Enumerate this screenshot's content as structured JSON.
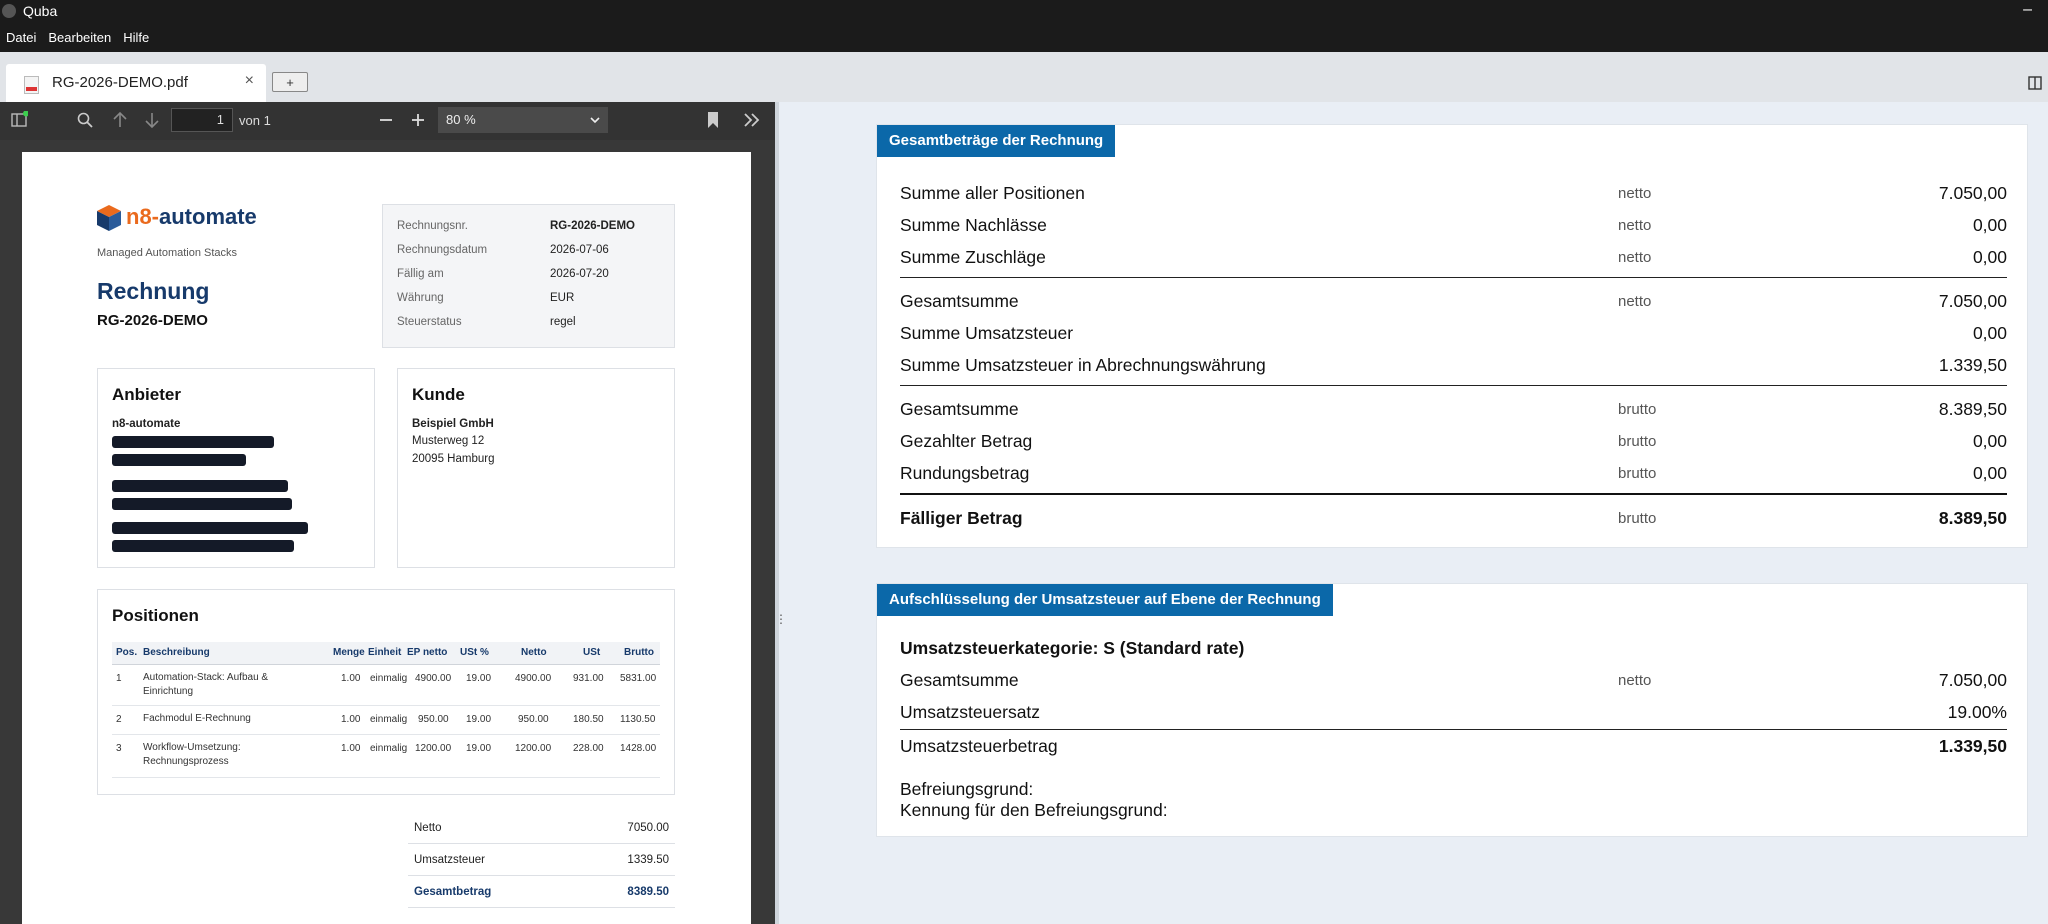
{
  "app": {
    "title": "Quba",
    "menu": [
      "Datei",
      "Bearbeiten",
      "Hilfe"
    ],
    "minimize_glyph": "–"
  },
  "tabs": {
    "active_label": "RG-2026-DEMO.pdf",
    "close_glyph": "×",
    "new_tab_glyph": "+"
  },
  "viewer_toolbar": {
    "page_current": "1",
    "page_total_label": "von 1",
    "zoom": "80 %"
  },
  "invoice": {
    "brand": {
      "part1": "n8-",
      "part2": "automate",
      "slogan": "Managed Automation Stacks"
    },
    "title": "Rechnung",
    "number": "RG-2026-DEMO",
    "meta": [
      {
        "k": "Rechnungsnr.",
        "v": "RG-2026-DEMO"
      },
      {
        "k": "Rechnungsdatum",
        "v": "2026-07-06"
      },
      {
        "k": "Fällig am",
        "v": "2026-07-20"
      },
      {
        "k": "Währung",
        "v": "EUR"
      },
      {
        "k": "Steuerstatus",
        "v": "regel"
      }
    ],
    "provider": {
      "heading": "Anbieter",
      "name": "n8-automate"
    },
    "customer": {
      "heading": "Kunde",
      "name": "Beispiel GmbH",
      "street": "Musterweg 12",
      "city": "20095 Hamburg"
    },
    "positions": {
      "heading": "Positionen",
      "columns": [
        "Pos.",
        "Beschreibung",
        "Menge",
        "Einheit",
        "EP netto",
        "USt %",
        "Netto",
        "USt",
        "Brutto"
      ],
      "rows": [
        {
          "pos": "1",
          "desc": "Automation-Stack: Aufbau & Einrichtung",
          "qty": "1.00",
          "unit": "einmalig",
          "ep": "4900.00",
          "vat": "19.00",
          "net": "4900.00",
          "ust": "931.00",
          "gross": "5831.00"
        },
        {
          "pos": "2",
          "desc": "Fachmodul E-Rechnung",
          "qty": "1.00",
          "unit": "einmalig",
          "ep": "950.00",
          "vat": "19.00",
          "net": "950.00",
          "ust": "180.50",
          "gross": "1130.50"
        },
        {
          "pos": "3",
          "desc": "Workflow-Umsetzung: Rechnungsprozess",
          "qty": "1.00",
          "unit": "einmalig",
          "ep": "1200.00",
          "vat": "19.00",
          "net": "1200.00",
          "ust": "228.00",
          "gross": "1428.00"
        }
      ]
    },
    "totals": [
      {
        "k": "Netto",
        "v": "7050.00"
      },
      {
        "k": "Umsatzsteuer",
        "v": "1339.50"
      },
      {
        "k": "Gesamtbetrag",
        "v": "8389.50"
      }
    ]
  },
  "summary_card": {
    "heading": "Gesamtbeträge der Rechnung",
    "rows": [
      {
        "k": "Summe aller Positionen",
        "q": "netto",
        "v": "7.050,00"
      },
      {
        "k": "Summe Nachlässe",
        "q": "netto",
        "v": "0,00"
      },
      {
        "k": "Summe Zuschläge",
        "q": "netto",
        "v": "0,00"
      },
      {
        "k": "Gesamtsumme",
        "q": "netto",
        "v": "7.050,00"
      },
      {
        "k": "Summe Umsatzsteuer",
        "q": "",
        "v": "0,00"
      },
      {
        "k": "Summe Umsatzsteuer in Abrechnungswährung",
        "q": "",
        "v": "1.339,50"
      },
      {
        "k": "Gesamtsumme",
        "q": "brutto",
        "v": "8.389,50"
      },
      {
        "k": "Gezahlter Betrag",
        "q": "brutto",
        "v": "0,00"
      },
      {
        "k": "Rundungsbetrag",
        "q": "brutto",
        "v": "0,00"
      },
      {
        "k": "Fälliger Betrag",
        "q": "brutto",
        "v": "8.389,50"
      }
    ]
  },
  "vat_card": {
    "heading": "Aufschlüsselung der Umsatzsteuer auf Ebene der Rechnung",
    "category": "Umsatzsteuerkategorie: S (Standard rate)",
    "rows": [
      {
        "k": "Gesamtsumme",
        "q": "netto",
        "v": "7.050,00"
      },
      {
        "k": "Umsatzsteuersatz",
        "q": "",
        "v": "19.00%"
      },
      {
        "k": "Umsatzsteuerbetrag",
        "q": "",
        "v": "1.339,50"
      }
    ],
    "exemption_reason_label": "Befreiungsgrund:",
    "exemption_code_label": "Kennung für den Befreiungsgrund:"
  },
  "icons": [
    "sidebar-toggle-icon",
    "search-icon",
    "arrow-up-icon",
    "arrow-down-icon",
    "zoom-out-icon",
    "zoom-in-icon",
    "bookmark-icon",
    "more-tools-icon",
    "split-view-icon",
    "pdf-file-icon",
    "close-icon"
  ],
  "colors": {
    "accent_blue": "#0b68a9",
    "brand_navy": "#173a6b",
    "brand_orange": "#ea6a1d"
  }
}
